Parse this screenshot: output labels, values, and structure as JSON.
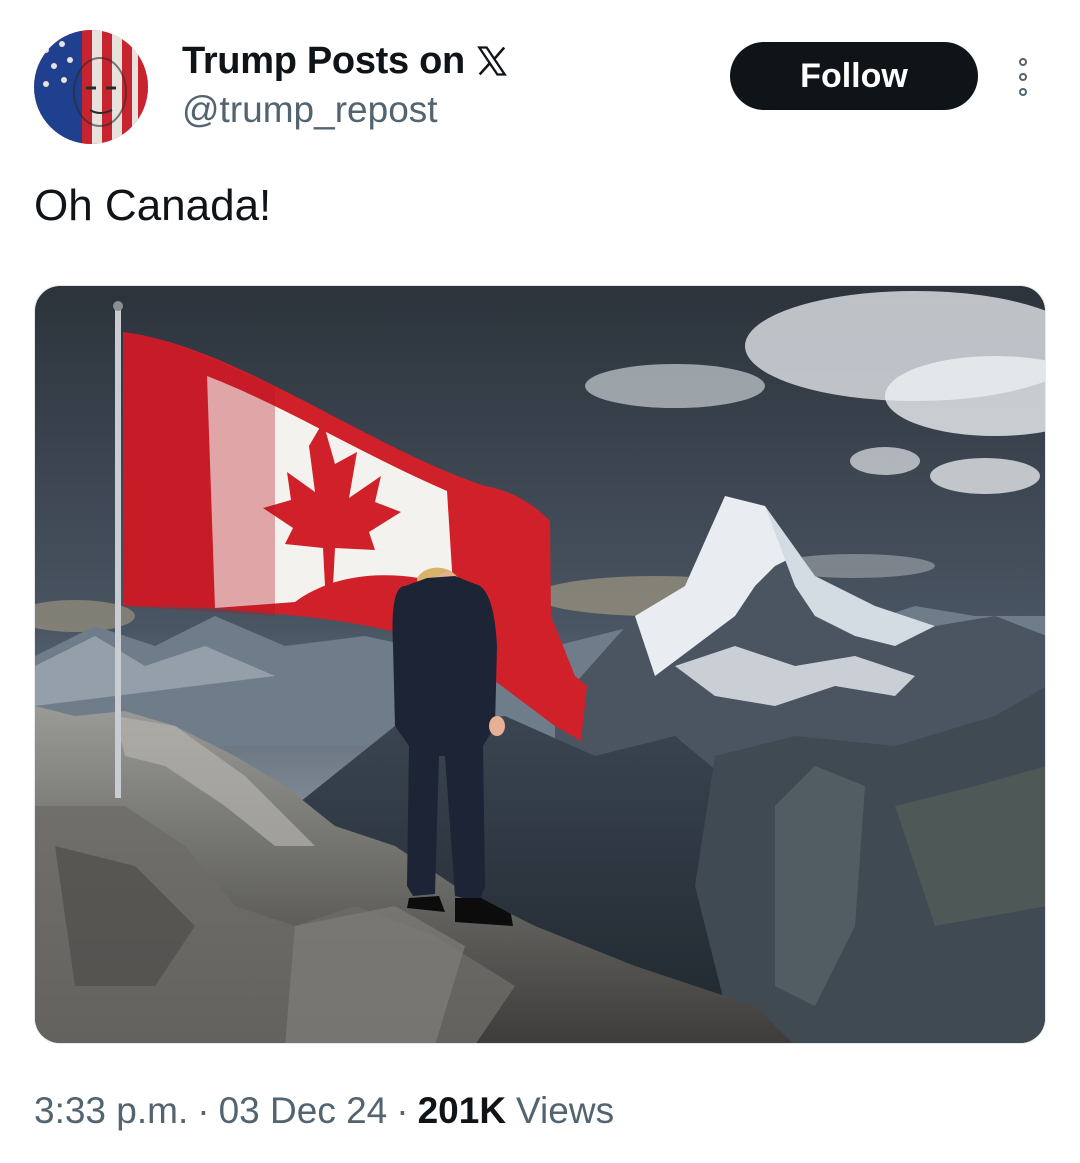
{
  "author": {
    "display_name": "Trump Posts on",
    "verified_glyph": "x-logo-icon",
    "handle": "@trump_repost",
    "avatar": "flag-face-avatar"
  },
  "actions": {
    "follow_label": "Follow",
    "more_icon": "more-vertical-icon"
  },
  "post": {
    "text": "Oh Canada!",
    "media": "photo-canada-flag-mountain"
  },
  "meta": {
    "time": "3:33 p.m.",
    "date": "03 Dec 24",
    "views_count": "201K",
    "views_label": "Views"
  },
  "colors": {
    "text_primary": "#0f1419",
    "text_secondary": "#536471",
    "button_bg": "#0f1419",
    "flag_red": "#d0202a"
  }
}
